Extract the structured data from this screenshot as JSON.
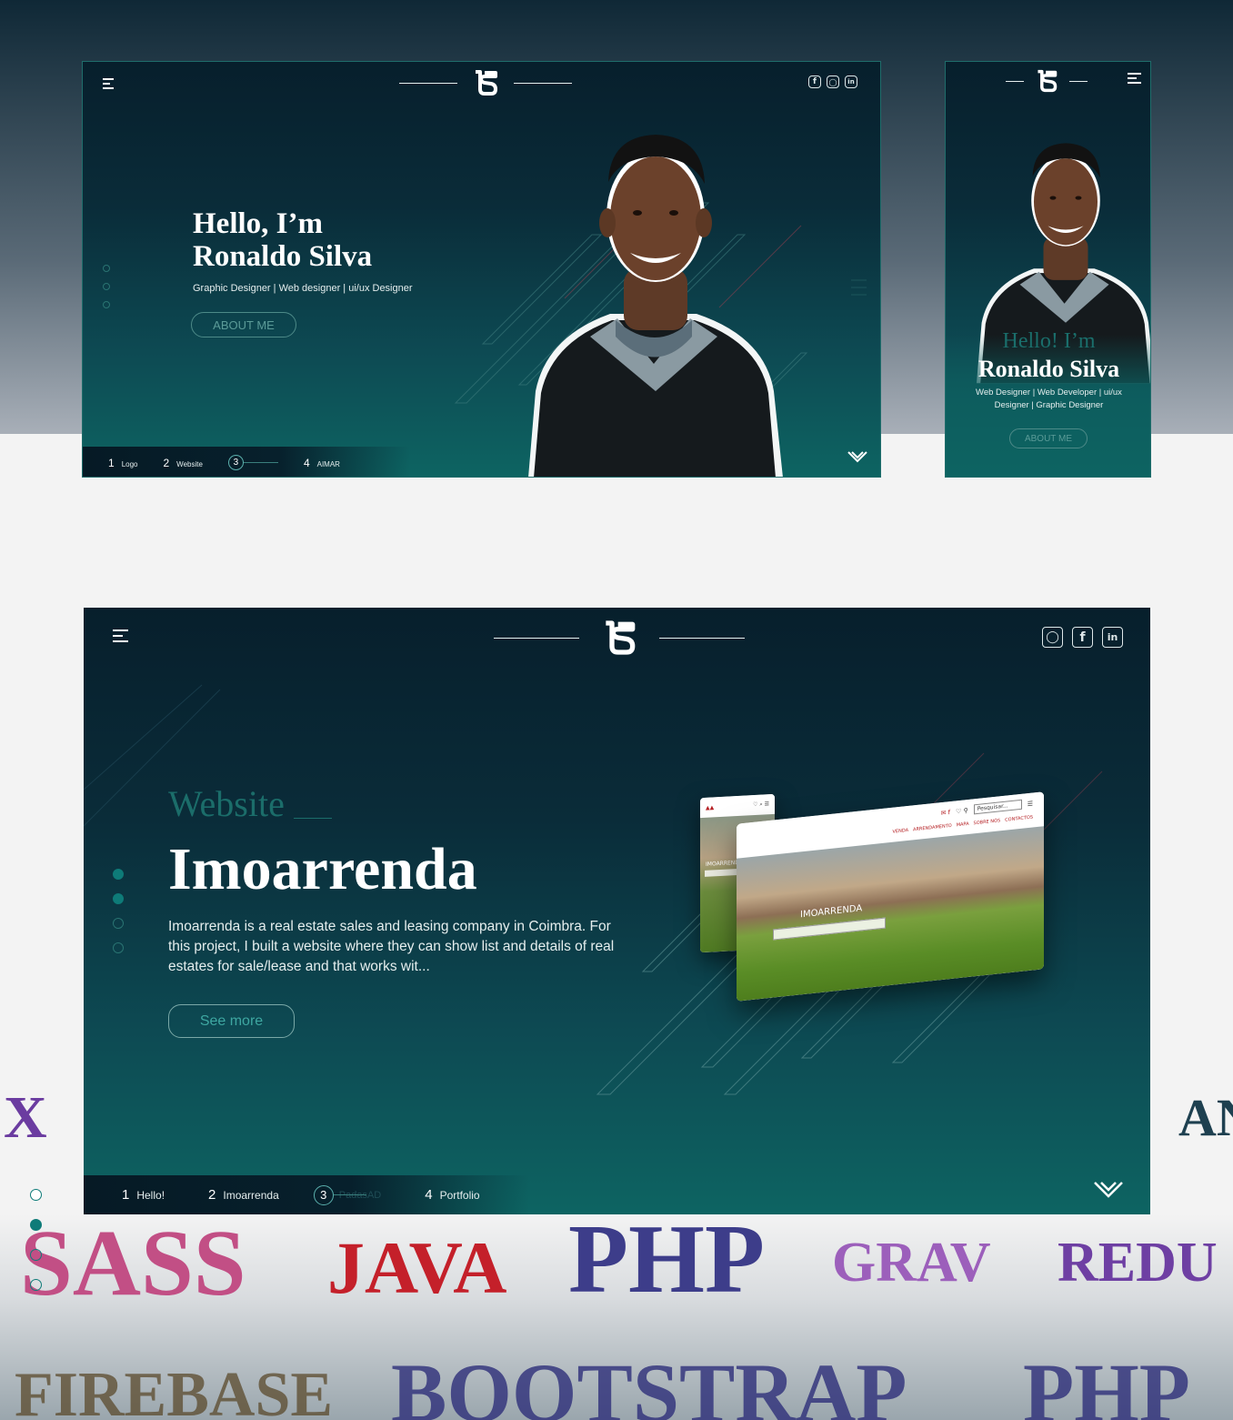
{
  "brand": {
    "logo_text": "S"
  },
  "desktop": {
    "hero_line1": "Hello, I’m",
    "hero_line2": "Ronaldo Silva",
    "tagline": "Graphic Designer | Web designer | ui/ux Designer",
    "about_button": "ABOUT ME",
    "nav": [
      {
        "num": "1",
        "label": "Logo"
      },
      {
        "num": "2",
        "label": "Website"
      },
      {
        "num": "3",
        "label": ""
      },
      {
        "num": "4",
        "label": "AIMAR"
      }
    ]
  },
  "mobile": {
    "hero_line1": "Hello! I’m",
    "hero_line2": "Ronaldo Silva",
    "tagline": "Web Designer | Web Developer | ui/ux Designer | Graphic Designer",
    "about_button": "ABOUT ME"
  },
  "project": {
    "category": "Website",
    "title": "Imoarrenda",
    "description": "Imoarrenda is a real estate sales and leasing company in Coimbra. For this project, I built a website where they can show list and details of real estates for sale/lease and that works wit...",
    "see_more": "See more",
    "mock": {
      "brand": "IMOARRENDA",
      "search_placeholder": "Pesquisar...",
      "menu": [
        "VENDA",
        "ARRENDAMENTO",
        "MAPA",
        "SOBRE NÓS",
        "CONTACTOS"
      ]
    },
    "nav": [
      {
        "num": "1",
        "label": "Hello!"
      },
      {
        "num": "2",
        "label": "Imoarrenda"
      },
      {
        "num": "3",
        "label": "PadasAD"
      },
      {
        "num": "4",
        "label": "Portfolio"
      }
    ]
  },
  "skills": {
    "row1": [
      "SASS",
      "JAVA",
      "PHP",
      "GRAV",
      "REDU"
    ],
    "row2": [
      "FIREBASE",
      "BOOTSTRAP",
      "PHP"
    ],
    "edge_left": "X",
    "edge_right": "AN"
  },
  "colors": {
    "accent": "#0e7b78",
    "sass": "#c24f85",
    "java": "#c4202a",
    "php": "#3d3d8a",
    "grav": "#9c5fbb",
    "redux": "#6e3fa3"
  }
}
